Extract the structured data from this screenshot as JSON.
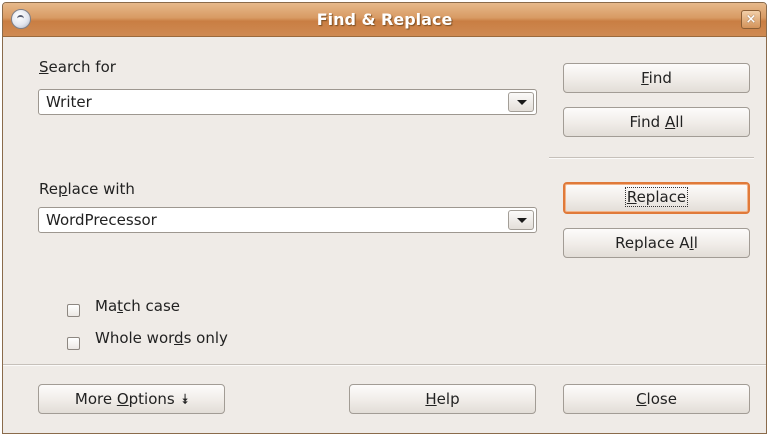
{
  "window": {
    "title": "Find & Replace",
    "close_glyph": "×",
    "icon": "openoffice-icon"
  },
  "search": {
    "label_pre": "",
    "label_mn": "S",
    "label_post": "earch for",
    "value": "Writer"
  },
  "replace": {
    "label_pre": "Re",
    "label_mn": "p",
    "label_post": "lace with",
    "value": "WordPrecessor"
  },
  "buttons": {
    "find": {
      "pre": "",
      "mn": "F",
      "post": "ind"
    },
    "find_all": {
      "pre": "Find ",
      "mn": "A",
      "post": "ll"
    },
    "replace": {
      "pre": "",
      "mn": "R",
      "post": "eplace"
    },
    "replace_all": {
      "pre": "Replace A",
      "mn": "l",
      "post": "l"
    },
    "more_options": {
      "pre": "More ",
      "mn": "O",
      "post": "ptions",
      "glyph": "⯯"
    },
    "help": {
      "pre": "",
      "mn": "H",
      "post": "elp"
    },
    "close": {
      "pre": "",
      "mn": "C",
      "post": "lose"
    }
  },
  "options": {
    "match_case": {
      "pre": "Ma",
      "mn": "t",
      "post": "ch case",
      "checked": false
    },
    "whole_words": {
      "pre": "Whole wor",
      "mn": "d",
      "post": "s only",
      "checked": false
    }
  }
}
